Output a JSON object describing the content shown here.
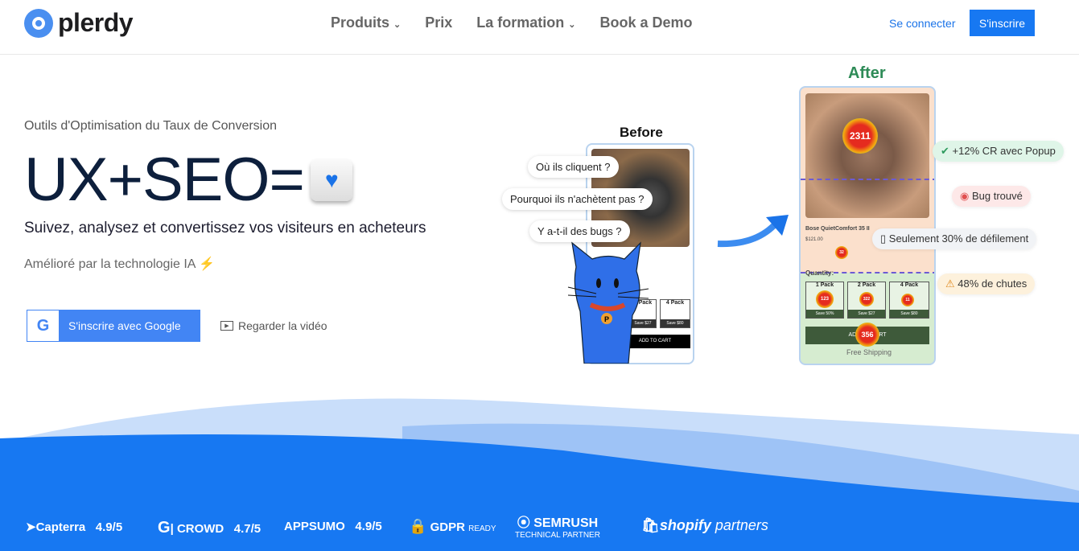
{
  "header": {
    "logo": "plerdy",
    "nav": [
      {
        "label": "Produits",
        "dropdown": true
      },
      {
        "label": "Prix",
        "dropdown": false
      },
      {
        "label": "La formation",
        "dropdown": true
      },
      {
        "label": "Book a Demo",
        "dropdown": false
      }
    ],
    "login": "Se connecter",
    "signup": "S'inscrire"
  },
  "hero": {
    "subtitle": "Outils d'Optimisation du Taux de Conversion",
    "title": "UX+SEO=",
    "tagline": "Suivez, analysez et convertissez vos visiteurs en acheteurs",
    "ai": "Amélioré par la technologie IA",
    "google_button": "S'inscrire avec Google",
    "video_link": "Regarder la vidéo"
  },
  "illustration": {
    "before_label": "Before",
    "after_label": "After",
    "questions": [
      "Où ils cliquent ?",
      "Pourquoi ils n'achètent pas ?",
      "Y a-t-il des bugs ?"
    ],
    "insights": [
      "+12% CR avec Popup",
      "Bug trouvé",
      "Seulement 30% de défilement",
      "48% de chutes"
    ],
    "product": {
      "name": "Bose QuietComfort 35 II",
      "price": "$121.00",
      "quantity_label": "Quantity:",
      "packs": [
        {
          "label": "1 Pack",
          "save": "Save 50%"
        },
        {
          "label": "2 Pack",
          "save": "Save $27"
        },
        {
          "label": "4 Pack",
          "save": "Save $80"
        }
      ],
      "cta": "ADD TO CART",
      "shipping": "Free Shipping"
    },
    "heat": {
      "main": "2311",
      "p1": "123",
      "p2": "322",
      "p3": "11",
      "cart": "356",
      "desc": "32"
    }
  },
  "brands": [
    {
      "name": "Capterra",
      "rating": "4.9/5"
    },
    {
      "name": "CROWD",
      "rating": "4.7/5"
    },
    {
      "name": "APPSUMO",
      "rating": "4.9/5"
    },
    {
      "name": "GDPR",
      "extra": "READY"
    },
    {
      "name": "SEMRUSH",
      "extra": "TECHNICAL PARTNER"
    },
    {
      "name": "shopify",
      "extra": "partners"
    }
  ],
  "colors": {
    "primary": "#1778f2",
    "after_label": "#2e8b57"
  }
}
